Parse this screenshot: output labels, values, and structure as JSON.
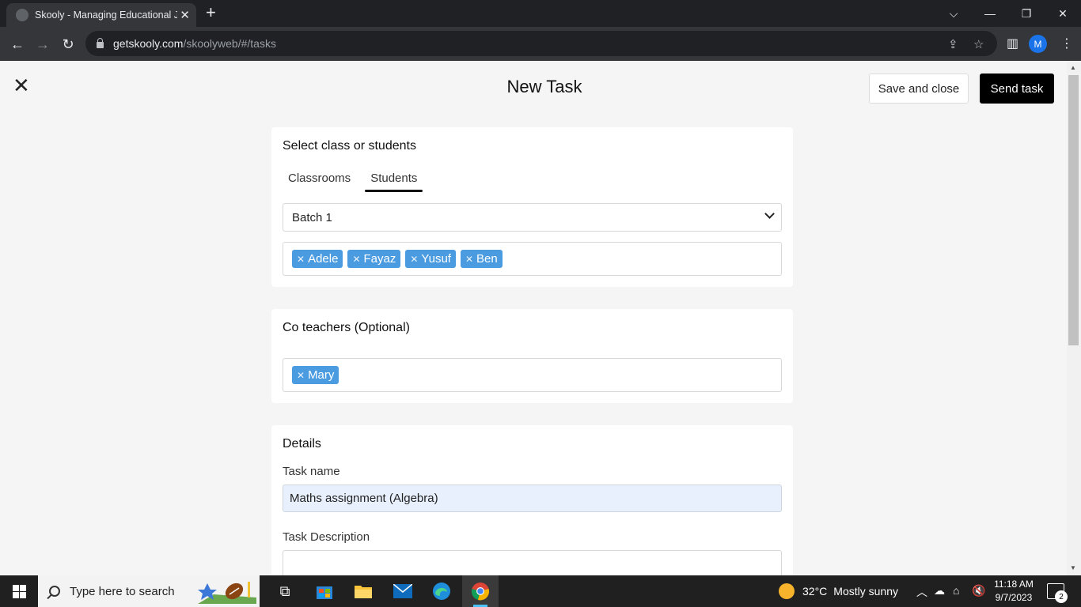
{
  "browser": {
    "tab_title": "Skooly - Managing Educational Ja",
    "url_host": "getskooly.com",
    "url_path": "/skoolyweb/#/tasks",
    "profile_initial": "M"
  },
  "header": {
    "title": "New Task",
    "save_label": "Save and close",
    "send_label": "Send task"
  },
  "select_students": {
    "title": "Select class or students",
    "tabs": [
      "Classrooms",
      "Students"
    ],
    "active_tab": "Students",
    "batch_value": "Batch 1",
    "students": [
      "Adele",
      "Fayaz",
      "Yusuf",
      "Ben"
    ]
  },
  "co_teachers": {
    "title": "Co teachers (Optional)",
    "teachers": [
      "Mary"
    ]
  },
  "details": {
    "title": "Details",
    "task_name_label": "Task name",
    "task_name_value": "Maths assignment (Algebra)",
    "task_description_label": "Task Description",
    "task_description_value": ""
  },
  "taskbar": {
    "search_placeholder": "Type here to search",
    "weather_temp": "32°C",
    "weather_text": "Mostly sunny",
    "time": "11:18 AM",
    "date": "9/7/2023",
    "notification_count": "2"
  },
  "colors": {
    "tag_blue": "#4a9be0",
    "send_button": "#000000",
    "input_autofill": "#e8f0fe"
  }
}
